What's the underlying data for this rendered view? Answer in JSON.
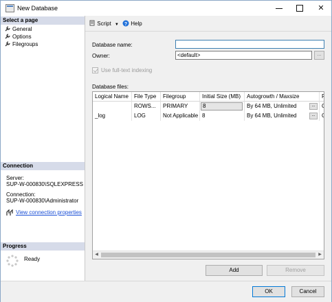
{
  "window": {
    "title": "New Database"
  },
  "left": {
    "select_page_heading": "Select a page",
    "pages": [
      "General",
      "Options",
      "Filegroups"
    ],
    "connection_heading": "Connection",
    "server_label": "Server:",
    "server_value": "SUP-W-000830\\SQLEXPRESS",
    "connection_label": "Connection:",
    "connection_value": "SUP-W-000830\\Administrator",
    "view_props_link": "View connection properties",
    "progress_heading": "Progress",
    "progress_status": "Ready"
  },
  "toolbar": {
    "script_label": "Script",
    "help_label": "Help"
  },
  "form": {
    "db_name_label": "Database name:",
    "db_name_value": "",
    "owner_label": "Owner:",
    "owner_value": "<default>",
    "fulltext_label": "Use full-text indexing",
    "files_label": "Database files:"
  },
  "grid": {
    "columns": [
      "Logical Name",
      "File Type",
      "Filegroup",
      "Initial Size (MB)",
      "Autogrowth / Maxsize",
      "P"
    ],
    "rows": [
      {
        "logical": "",
        "type": "ROWS...",
        "filegroup": "PRIMARY",
        "size": "8",
        "autogrowth": "By 64 MB, Unlimited",
        "path": "C"
      },
      {
        "logical": "_log",
        "type": "LOG",
        "filegroup": "Not Applicable",
        "size": "8",
        "autogrowth": "By 64 MB, Unlimited",
        "path": "C"
      }
    ]
  },
  "buttons": {
    "add": "Add",
    "remove": "Remove",
    "ok": "OK",
    "cancel": "Cancel",
    "ellipsis": "..."
  },
  "colors": {
    "section_header": "#d6dbe9",
    "link": "#1a4fd6",
    "help_icon": "#1e6fd9"
  }
}
